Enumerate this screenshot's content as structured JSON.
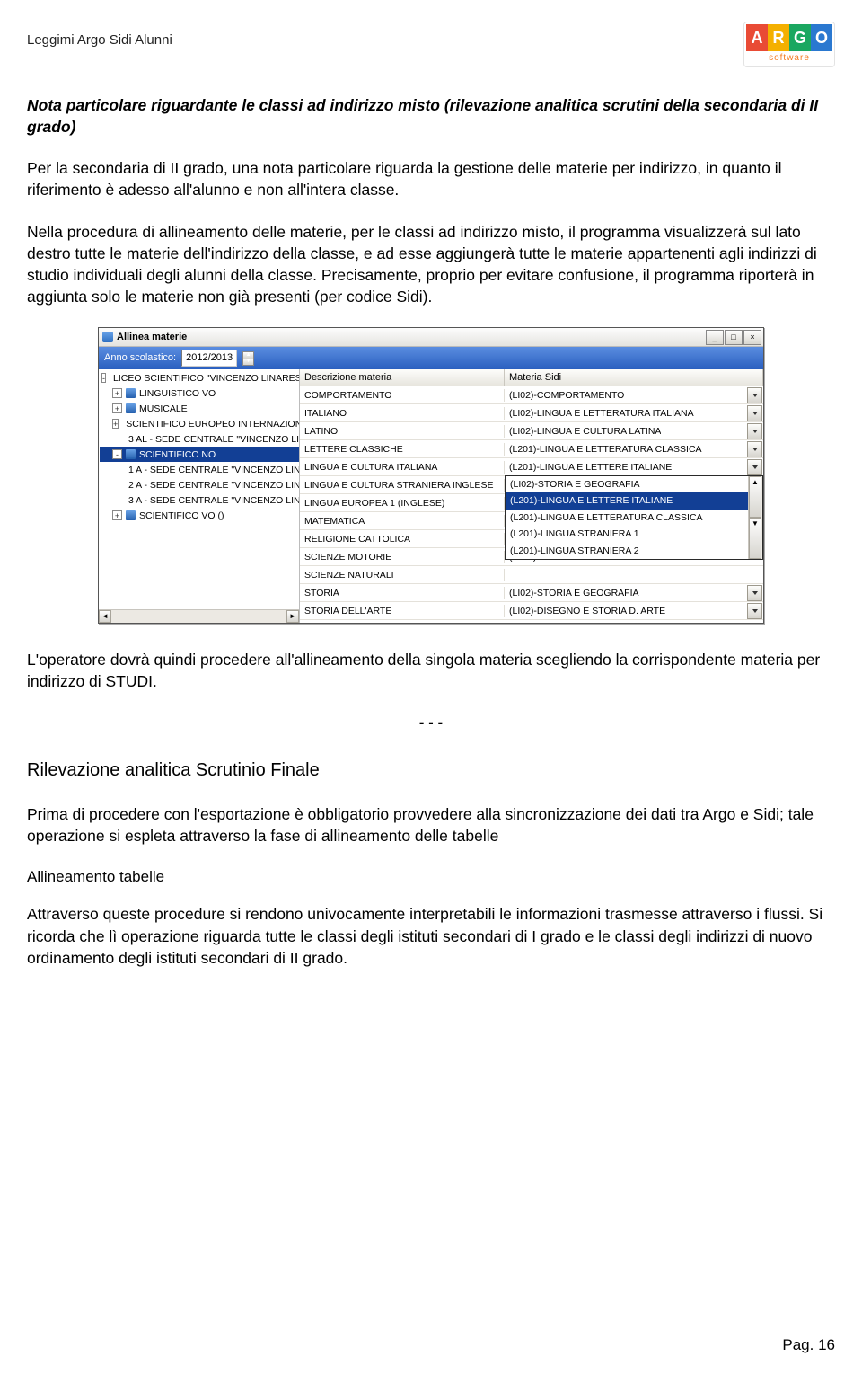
{
  "header": {
    "running_head": "Leggimi Argo Sidi Alunni",
    "logo_letters": [
      "A",
      "R",
      "G",
      "O"
    ],
    "logo_colors": [
      "#e94b35",
      "#f4b000",
      "#1aa760",
      "#2a78d0"
    ],
    "logo_sub": "software"
  },
  "doc": {
    "h1": "Nota particolare riguardante le classi ad indirizzo misto (rilevazione analitica scrutini della secondaria di II grado)",
    "p1": "Per la secondaria di II grado, una nota particolare riguarda la gestione delle materie per indirizzo, in quanto il riferimento è adesso all'alunno e non all'intera classe.",
    "p2": "Nella procedura di allineamento delle materie, per le classi ad indirizzo misto, il programma visualizzerà sul lato destro tutte le materie dell'indirizzo della classe, e ad esse aggiungerà tutte le materie appartenenti agli indirizzi di studio individuali degli alunni della classe. Precisamente, proprio per evitare confusione, il programma riporterà in aggiunta solo le materie non già presenti (per codice Sidi).",
    "p3": "L'operatore dovrà quindi procedere all'allineamento della singola materia scegliendo la corrispondente materia per indirizzo di STUDI.",
    "sep": "- - -",
    "sec_title": "Rilevazione analitica Scrutinio Finale",
    "p4": "Prima di procedere con l'esportazione è obbligatorio provvedere alla sincronizzazione dei dati tra Argo e Sidi; tale operazione si espleta attraverso la fase di allineamento delle tabelle",
    "sub_title": "Allineamento tabelle",
    "p5": "Attraverso queste procedure si rendono univocamente interpretabili le informazioni trasmesse attraverso i flussi. Si ricorda che lì operazione riguarda tutte le classi degli istituti secondari di I grado e le classi degli indirizzi di nuovo ordinamento degli istituti secondari di II grado.",
    "page_num": "Pag. 16"
  },
  "app": {
    "title": "Allinea materie",
    "toolbar_label": "Anno scolastico:",
    "year": "2012/2013",
    "tree": [
      {
        "lvl": 0,
        "exp": "-",
        "ico": "hat",
        "txt": "LICEO SCIENTIFICO \"VINCENZO LINARES\""
      },
      {
        "lvl": 1,
        "exp": "+",
        "ico": "sq-b",
        "txt": "LINGUISTICO VO"
      },
      {
        "lvl": 1,
        "exp": "+",
        "ico": "sq-b",
        "txt": "MUSICALE"
      },
      {
        "lvl": 1,
        "exp": "+",
        "ico": "sq-b",
        "txt": "SCIENTIFICO EUROPEO INTERNAZIONALE"
      },
      {
        "lvl": 2,
        "exp": "",
        "ico": "sq-b",
        "txt": "3 AL - SEDE CENTRALE \"VINCENZO LI"
      },
      {
        "lvl": 1,
        "exp": "-",
        "ico": "sq-b",
        "txt": "SCIENTIFICO NO",
        "sel": true
      },
      {
        "lvl": 2,
        "exp": "",
        "ico": "sq-r",
        "txt": "1 A  - SEDE CENTRALE \"VINCENZO LIN"
      },
      {
        "lvl": 2,
        "exp": "",
        "ico": "sq-r",
        "txt": "2 A  - SEDE CENTRALE \"VINCENZO LIN"
      },
      {
        "lvl": 2,
        "exp": "",
        "ico": "sq-r",
        "txt": "3 A  - SEDE CENTRALE \"VINCENZO LIN"
      },
      {
        "lvl": 1,
        "exp": "+",
        "ico": "sq-b",
        "txt": "SCIENTIFICO VO ()"
      }
    ],
    "cols": {
      "a": "Descrizione materia",
      "b": "Materia Sidi"
    },
    "rows": [
      {
        "a": "COMPORTAMENTO",
        "b": "(LI02)-COMPORTAMENTO",
        "dd": true
      },
      {
        "a": "ITALIANO",
        "b": "(LI02)-LINGUA E LETTERATURA ITALIANA",
        "dd": true
      },
      {
        "a": "LATINO",
        "b": "(LI02)-LINGUA E CULTURA LATINA",
        "dd": true
      },
      {
        "a": "LETTERE CLASSICHE",
        "b": "(L201)-LINGUA E LETTERATURA CLASSICA",
        "dd": true
      },
      {
        "a": "LINGUA E CULTURA ITALIANA",
        "b": "(L201)-LINGUA E LETTERE ITALIANE",
        "dd": true,
        "open": true
      },
      {
        "a": "LINGUA E CULTURA STRANIERA INGLESE",
        "b": "(LI02)-STORIA E GEOGRAFIA"
      },
      {
        "a": "LINGUA EUROPEA 1 (INGLESE)",
        "b": "(L201)-LINGUA E LETTERE ITALIANE"
      },
      {
        "a": "MATEMATICA",
        "b": "(L201)-LINGUA E LETTERATURA CLASSICA"
      },
      {
        "a": "RELIGIONE CATTOLICA",
        "b": "(L201)-LINGUA STRANIERA 1"
      },
      {
        "a": "SCIENZE MOTORIE",
        "b": "(L201)-LINGUA STRANIERA 2"
      },
      {
        "a": "SCIENZE NATURALI",
        "b": ""
      },
      {
        "a": "STORIA",
        "b": "(LI02)-STORIA E GEOGRAFIA",
        "dd": true
      },
      {
        "a": "STORIA DELL'ARTE",
        "b": "(LI02)-DISEGNO E STORIA D. ARTE",
        "dd": true
      }
    ],
    "dropdown_for_row": 4,
    "dropdown_options": [
      "(LI02)-STORIA E GEOGRAFIA",
      "(L201)-LINGUA E LETTERE ITALIANE",
      "(L201)-LINGUA E LETTERATURA CLASSICA",
      "(L201)-LINGUA STRANIERA 1",
      "(L201)-LINGUA STRANIERA 2"
    ],
    "dropdown_selected_index": 1
  }
}
